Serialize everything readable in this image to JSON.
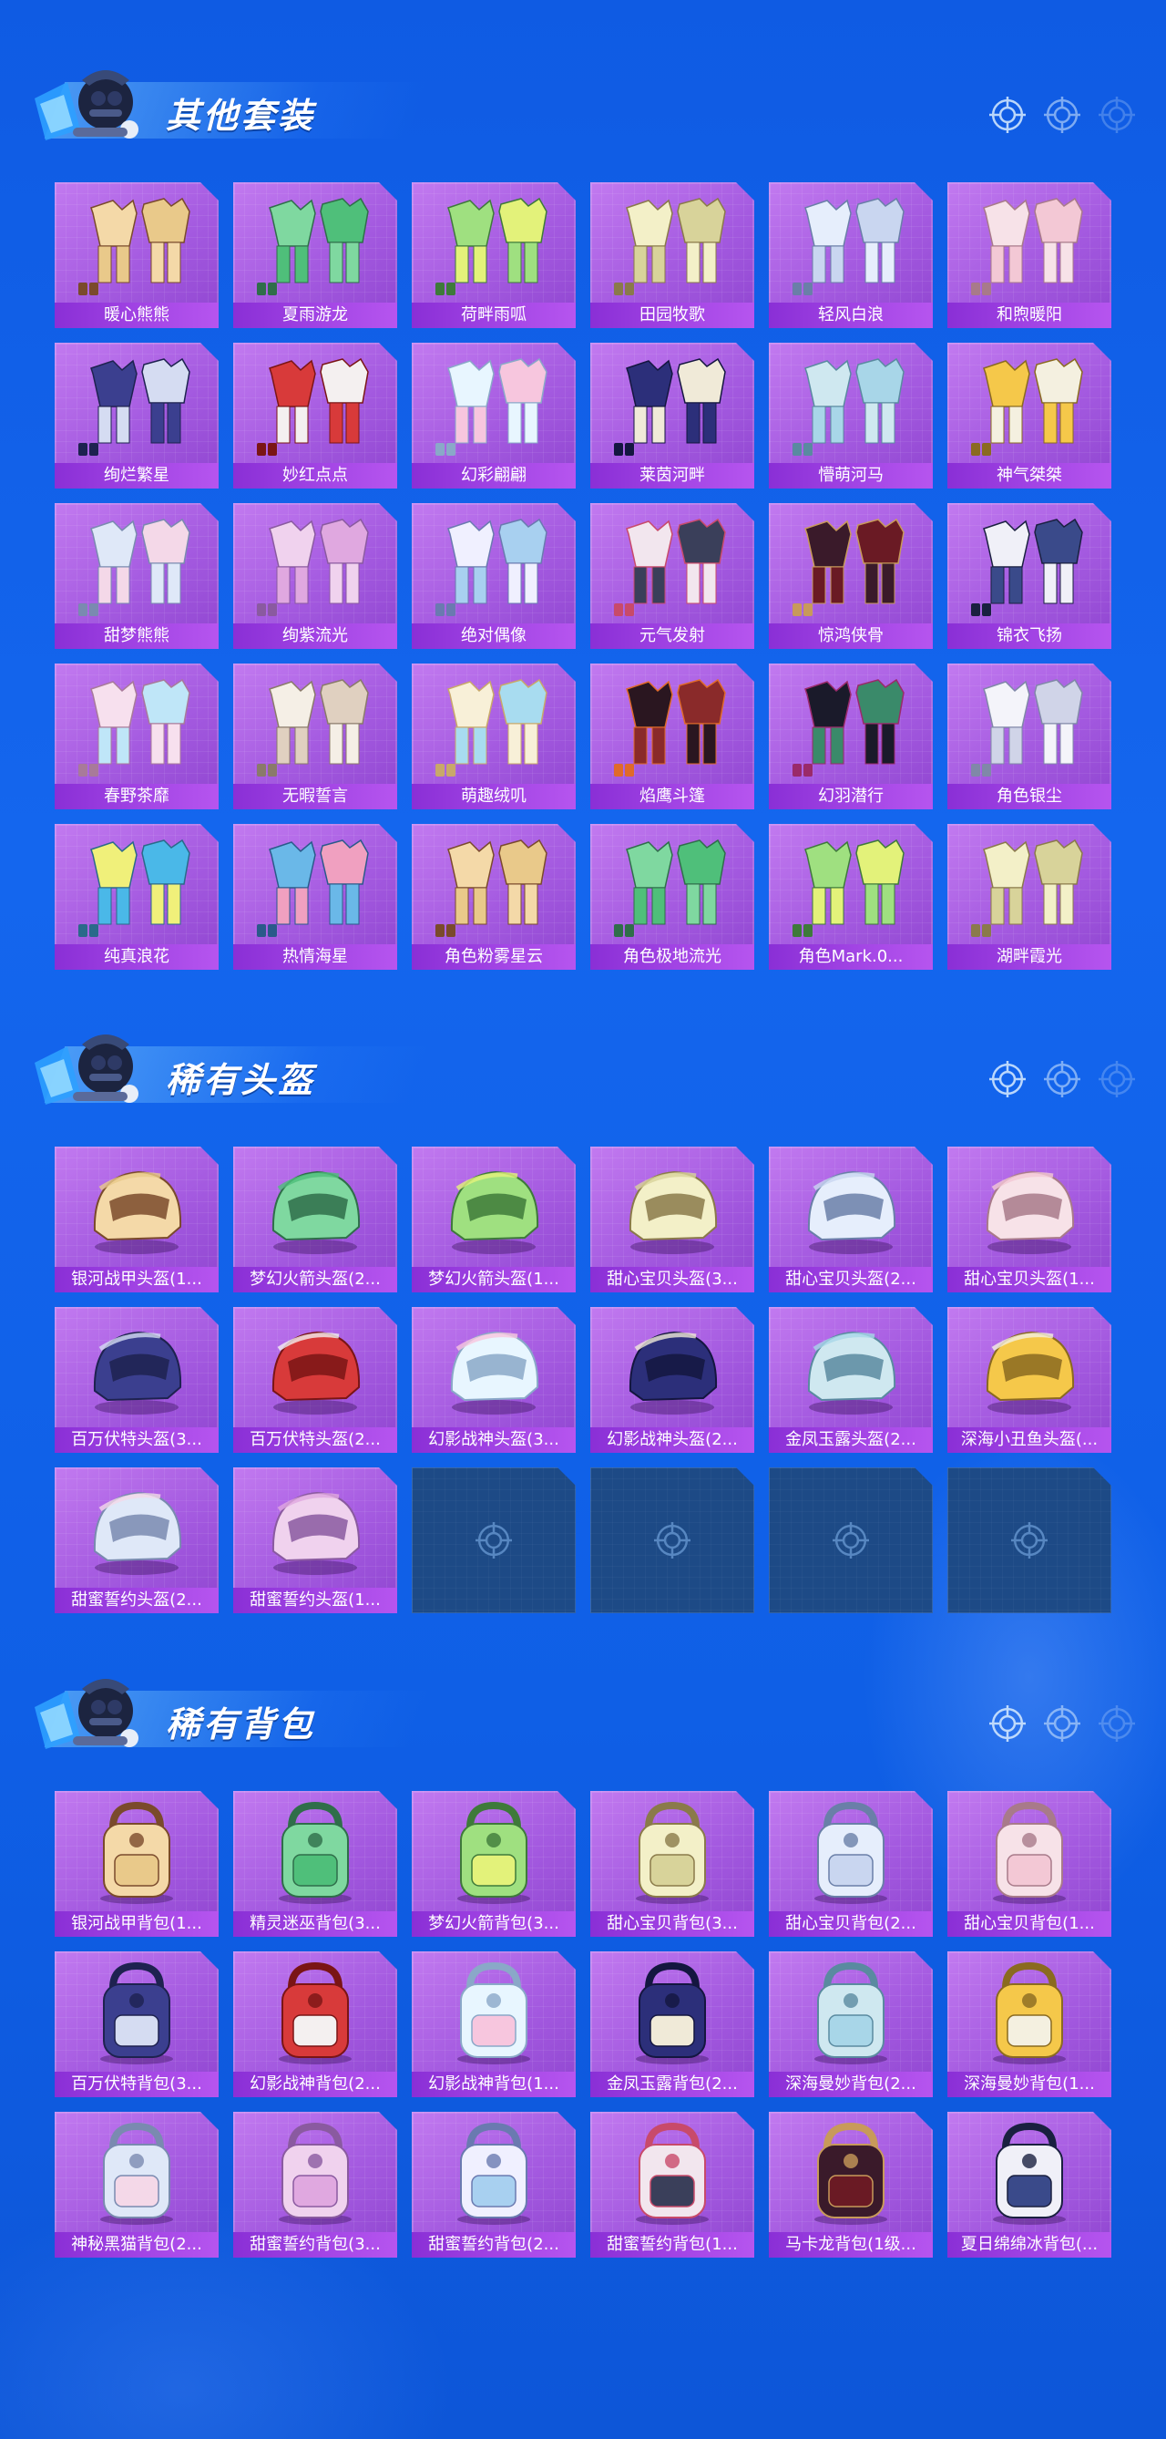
{
  "colors": {
    "background": "#1466ee",
    "card_purple": "#a45ae0",
    "card_label": "#8a2fd6",
    "empty_slot": "#1d4a86"
  },
  "icons": {
    "section_emblem": "character-emblem-icon",
    "header_decoration": "target-icon",
    "empty_slot": "target-icon"
  },
  "sections": [
    {
      "title": "其他套装",
      "kind": "outfit",
      "items": [
        "暖心熊熊",
        "夏雨游龙",
        "荷畔雨呱",
        "田园牧歌",
        "轻风白浪",
        "和煦暖阳",
        "绚烂繁星",
        "妙红点点",
        "幻彩翩翩",
        "莱茵河畔",
        "懵萌河马",
        "神气桀桀",
        "甜梦熊熊",
        "绚紫流光",
        "绝对偶像",
        "元气发射",
        "惊鸿侠骨",
        "锦衣飞扬",
        "春野茶靡",
        "无暇誓言",
        "萌趣绒叽",
        "焰鹰斗篷",
        "幻羽潜行",
        "角色银尘",
        "纯真浪花",
        "热情海星",
        "角色粉雾星云",
        "角色极地流光",
        "角色Mark.0...",
        "湖畔霞光"
      ],
      "empty_slots": 0
    },
    {
      "title": "稀有头盔",
      "kind": "helmet",
      "items": [
        "银河战甲头盔(1...",
        "梦幻火箭头盔(2...",
        "梦幻火箭头盔(1...",
        "甜心宝贝头盔(3...",
        "甜心宝贝头盔(2...",
        "甜心宝贝头盔(1...",
        "百万伏特头盔(3...",
        "百万伏特头盔(2...",
        "幻影战神头盔(3...",
        "幻影战神头盔(2...",
        "金凤玉露头盔(2...",
        "深海小丑鱼头盔(...",
        "甜蜜誓约头盔(2...",
        "甜蜜誓约头盔(1..."
      ],
      "empty_slots": 4
    },
    {
      "title": "稀有背包",
      "kind": "backpack",
      "items": [
        "银河战甲背包(1...",
        "精灵迷巫背包(3...",
        "梦幻火箭背包(3...",
        "甜心宝贝背包(3...",
        "甜心宝贝背包(2...",
        "甜心宝贝背包(1...",
        "百万伏特背包(3...",
        "幻影战神背包(2...",
        "幻影战神背包(1...",
        "金凤玉露背包(2...",
        "深海曼妙背包(2...",
        "深海曼妙背包(1...",
        "神秘黑猫背包(2...",
        "甜蜜誓约背包(3...",
        "甜蜜誓约背包(2...",
        "甜蜜誓约背包(1...",
        "马卡龙背包(1级...",
        "夏日绵绵冰背包(..."
      ],
      "empty_slots": 0
    }
  ]
}
